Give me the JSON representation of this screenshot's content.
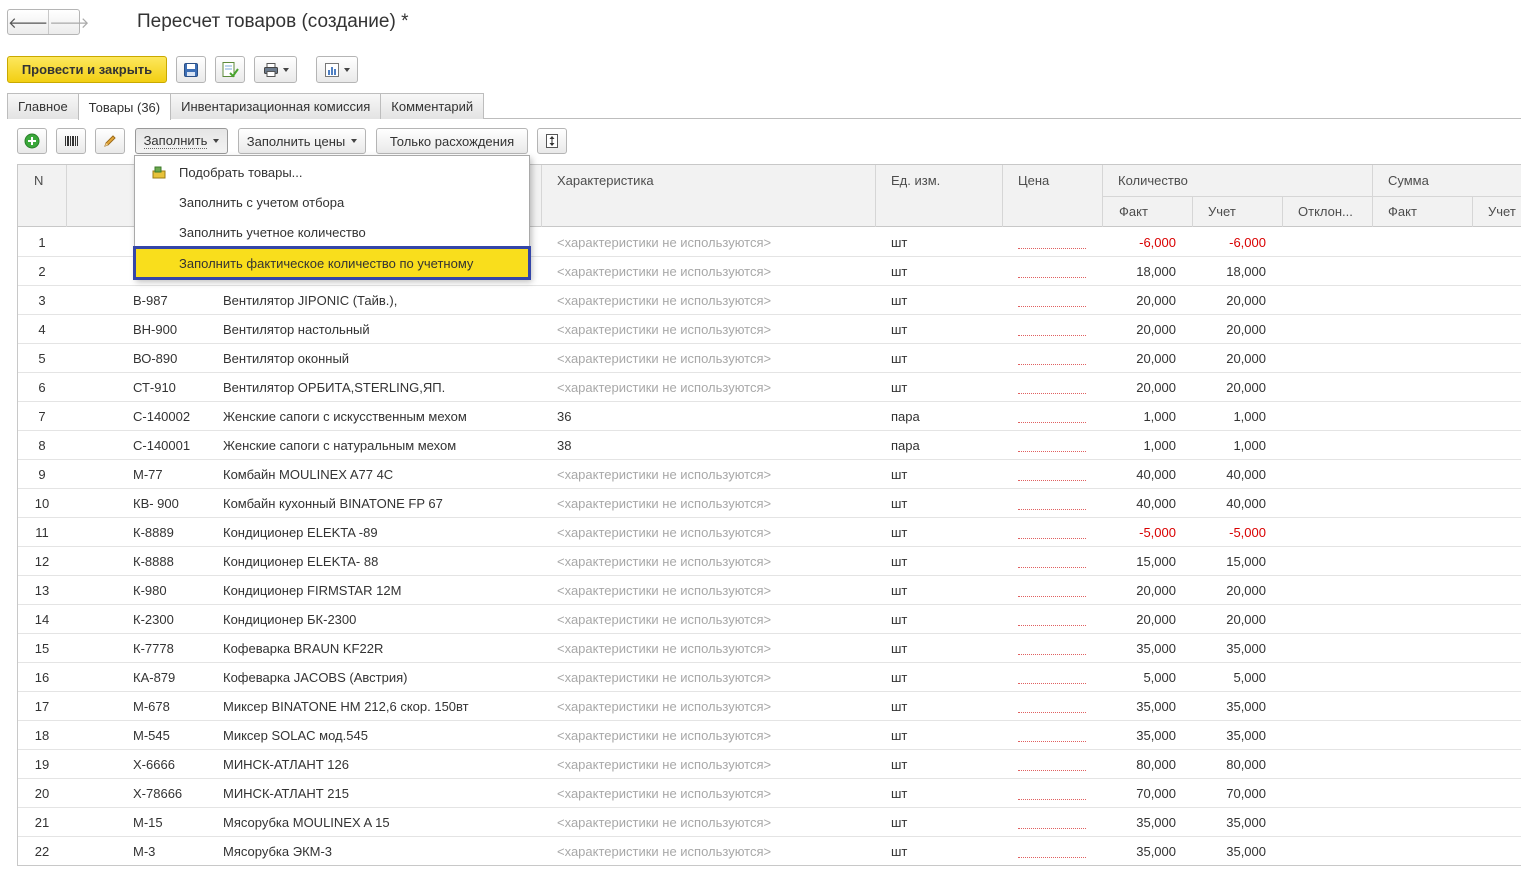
{
  "window": {
    "title": "Пересчет товаров (создание) *"
  },
  "nav": {
    "back_icon": "arrow-left-icon",
    "forward_icon": "arrow-right-icon",
    "back": "🡐",
    "forward": "🡒"
  },
  "toolbar": {
    "post_close_label": "Провести и закрыть",
    "save_icon": "floppy-disk-icon",
    "post_icon": "post-document-icon",
    "print_icon": "printer-icon",
    "report_icon": "report-icon"
  },
  "tabs": [
    "Главное",
    "Товары (36)",
    "Инвентаризационная комиссия",
    "Комментарий"
  ],
  "active_tab": "Товары (36)",
  "table_toolbar": {
    "add_icon": "plus-circle-icon",
    "barcode_icon": "barcode-icon",
    "edit_icon": "pencil-icon",
    "fill_label": "Заполнить",
    "fill_prices_label": "Заполнить цены",
    "only_diff_label": "Только расхождения",
    "height_icon": "row-height-icon"
  },
  "fill_menu": {
    "items": [
      "Подобрать товары...",
      "Заполнить с учетом отбора",
      "Заполнить учетное количество",
      "Заполнить фактическое количество по учетному"
    ],
    "highlighted": "Заполнить фактическое количество по учетному",
    "first_item_icon": "pick-goods-icon"
  },
  "columns": {
    "n": "N",
    "characteristic": "Характеристика",
    "unit": "Ед. изм.",
    "price": "Цена",
    "quantity": "Количество",
    "qty_fact": "Факт",
    "qty_account": "Учет",
    "qty_dev": "Отклон...",
    "sum": "Сумма",
    "sum_fact": "Факт",
    "sum_account": "Учет"
  },
  "rows": [
    {
      "n": "1",
      "art": "",
      "name": "",
      "char": "<характеристики не используются>",
      "unit": "шт",
      "fact": "-6,000",
      "acc": "-6,000",
      "neg": true
    },
    {
      "n": "2",
      "art": "",
      "name": "",
      "char": "<характеристики не используются>",
      "unit": "шт",
      "fact": "18,000",
      "acc": "18,000"
    },
    {
      "n": "3",
      "art": "В-987",
      "name": "Вентилятор JIPONIC (Тайв.),",
      "char": "<характеристики не используются>",
      "unit": "шт",
      "fact": "20,000",
      "acc": "20,000"
    },
    {
      "n": "4",
      "art": "ВН-900",
      "name": "Вентилятор настольный",
      "char": "<характеристики не используются>",
      "unit": "шт",
      "fact": "20,000",
      "acc": "20,000"
    },
    {
      "n": "5",
      "art": "ВО-890",
      "name": "Вентилятор оконный",
      "char": "<характеристики не используются>",
      "unit": "шт",
      "fact": "20,000",
      "acc": "20,000"
    },
    {
      "n": "6",
      "art": "СТ-910",
      "name": "Вентилятор ОРБИТА,STERLING,ЯП.",
      "char": "<характеристики не используются>",
      "unit": "шт",
      "fact": "20,000",
      "acc": "20,000"
    },
    {
      "n": "7",
      "art": "С-140002",
      "name": "Женские сапоги с искусственным мехом",
      "char": "36",
      "unit": "пара",
      "fact": "1,000",
      "acc": "1,000",
      "plain": true
    },
    {
      "n": "8",
      "art": "С-140001",
      "name": "Женские сапоги с натуральным мехом",
      "char": "38",
      "unit": "пара",
      "fact": "1,000",
      "acc": "1,000",
      "plain": true
    },
    {
      "n": "9",
      "art": "М-77",
      "name": "Комбайн MOULINEX  A77 4C",
      "char": "<характеристики не используются>",
      "unit": "шт",
      "fact": "40,000",
      "acc": "40,000"
    },
    {
      "n": "10",
      "art": "КВ- 900",
      "name": "Комбайн кухонный BINATONE FP 67",
      "char": "<характеристики не используются>",
      "unit": "шт",
      "fact": "40,000",
      "acc": "40,000"
    },
    {
      "n": "11",
      "art": "К-8889",
      "name": "Кондиционер ELEKTA -89",
      "char": "<характеристики не используются>",
      "unit": "шт",
      "fact": "-5,000",
      "acc": "-5,000",
      "neg": true
    },
    {
      "n": "12",
      "art": "К-8888",
      "name": "Кондиционер ELEKTA- 88",
      "char": "<характеристики не используются>",
      "unit": "шт",
      "fact": "15,000",
      "acc": "15,000"
    },
    {
      "n": "13",
      "art": "К-980",
      "name": "Кондиционер FIRMSTAR 12M",
      "char": "<характеристики не используются>",
      "unit": "шт",
      "fact": "20,000",
      "acc": "20,000"
    },
    {
      "n": "14",
      "art": "К-2300",
      "name": "Кондиционер БК-2300",
      "char": "<характеристики не используются>",
      "unit": "шт",
      "fact": "20,000",
      "acc": "20,000"
    },
    {
      "n": "15",
      "art": "К-7778",
      "name": "Кофеварка BRAUN KF22R",
      "char": "<характеристики не используются>",
      "unit": "шт",
      "fact": "35,000",
      "acc": "35,000"
    },
    {
      "n": "16",
      "art": "КА-879",
      "name": "Кофеварка JACOBS (Австрия)",
      "char": "<характеристики не используются>",
      "unit": "шт",
      "fact": "5,000",
      "acc": "5,000"
    },
    {
      "n": "17",
      "art": "М-678",
      "name": "Миксер BINATONE HM 212,6 скор. 150вт",
      "char": "<характеристики не используются>",
      "unit": "шт",
      "fact": "35,000",
      "acc": "35,000"
    },
    {
      "n": "18",
      "art": "М-545",
      "name": "Миксер SOLAC мод.545",
      "char": "<характеристики не используются>",
      "unit": "шт",
      "fact": "35,000",
      "acc": "35,000"
    },
    {
      "n": "19",
      "art": "Х-6666",
      "name": "МИНСК-АТЛАНТ 126",
      "char": "<характеристики не используются>",
      "unit": "шт",
      "fact": "80,000",
      "acc": "80,000"
    },
    {
      "n": "20",
      "art": "Х-78666",
      "name": "МИНСК-АТЛАНТ 215",
      "char": "<характеристики не используются>",
      "unit": "шт",
      "fact": "70,000",
      "acc": "70,000"
    },
    {
      "n": "21",
      "art": "М-15",
      "name": "Мясорубка MOULINEX  A 15",
      "char": "<характеристики не используются>",
      "unit": "шт",
      "fact": "35,000",
      "acc": "35,000"
    },
    {
      "n": "22",
      "art": "М-3",
      "name": "Мясорубка ЭКМ-3",
      "char": "<характеристики не используются>",
      "unit": "шт",
      "fact": "35,000",
      "acc": "35,000"
    }
  ]
}
